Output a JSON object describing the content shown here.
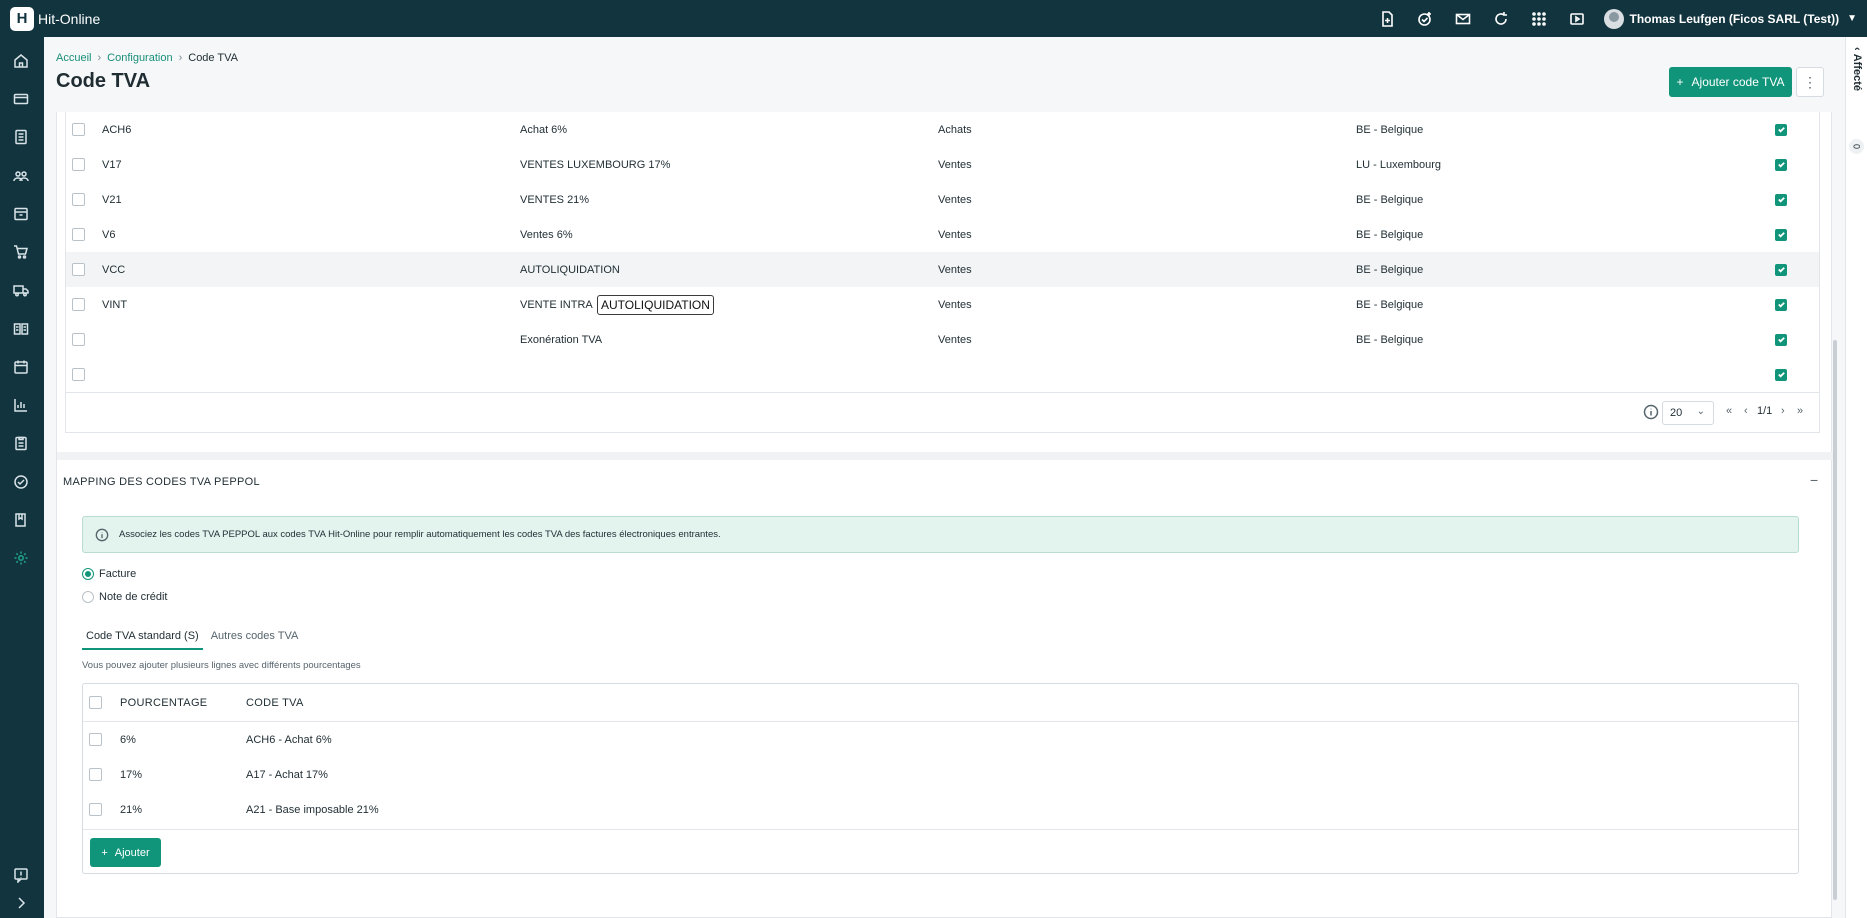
{
  "app": {
    "name": "Hit-Online",
    "logo_letter": "H"
  },
  "user": {
    "name": "Thomas Leufgen (Ficos SARL (Test))"
  },
  "top_icons": [
    "document-add-icon",
    "check-circle-plus-icon",
    "mail-icon",
    "refresh-icon",
    "grid-icon",
    "video-icon"
  ],
  "sidebar_icons": [
    "home-icon",
    "credit-card-icon",
    "document-icon",
    "users-icon",
    "box-icon",
    "cart-icon",
    "truck-icon",
    "ledger-icon",
    "calendar-icon",
    "chart-icon",
    "clipboard-icon",
    "check-icon",
    "book-icon",
    "gear-icon",
    "feedback-icon",
    "expand-icon"
  ],
  "right_panel": {
    "label": "Affecté",
    "count": "0"
  },
  "breadcrumb": {
    "home": "Accueil",
    "config": "Configuration",
    "current": "Code TVA"
  },
  "page": {
    "title": "Code TVA",
    "add_button": "Ajouter code TVA",
    "more_button": "⋮"
  },
  "tva_rows": [
    {
      "code": "ACH6",
      "description": "Achat 6%",
      "type": "Achats",
      "country": "BE - Belgique"
    },
    {
      "code": "V17",
      "description": "VENTES LUXEMBOURG 17%",
      "type": "Ventes",
      "country": "LU - Luxembourg"
    },
    {
      "code": "V21",
      "description": "VENTES 21%",
      "type": "Ventes",
      "country": "BE - Belgique"
    },
    {
      "code": "V6",
      "description": "Ventes 6%",
      "type": "Ventes",
      "country": "BE - Belgique"
    },
    {
      "code": "VCC",
      "description": "AUTOLIQUIDATION",
      "type": "Ventes",
      "country": "BE - Belgique"
    },
    {
      "code": "VINT",
      "description": "VENTE INTRA",
      "type": "Ventes",
      "country": "BE - Belgique"
    },
    {
      "code": "",
      "description": "Exonération TVA",
      "type": "Ventes",
      "country": "BE - Belgique"
    },
    {
      "code": "",
      "description": "",
      "type": "",
      "country": ""
    }
  ],
  "tooltip": "AUTOLIQUIDATION",
  "pager": {
    "page_size": "20",
    "page": "1/1"
  },
  "mapping": {
    "title": "MAPPING DES CODES TVA PEPPOL",
    "collapse": "−",
    "banner": "Associez les codes TVA PEPPOL aux codes TVA Hit-Online pour remplir automatiquement les codes TVA des factures électroniques entrantes.",
    "radio_facture": "Facture",
    "radio_credit": "Note de crédit",
    "tab_standard": "Code TVA standard (S)",
    "tab_other": "Autres codes TVA",
    "hint": "Vous pouvez ajouter plusieurs lignes avec différents pourcentages",
    "col_pct": "POURCENTAGE",
    "col_code": "CODE TVA",
    "rows": [
      {
        "pct": "6%",
        "code": "ACH6 - Achat 6%"
      },
      {
        "pct": "17%",
        "code": "A17 - Achat 17%"
      },
      {
        "pct": "21%",
        "code": "A21 - Base imposable 21%"
      }
    ],
    "add_button": "Ajouter"
  },
  "colors": {
    "topbar": "#12343f",
    "accent": "#11957a"
  }
}
